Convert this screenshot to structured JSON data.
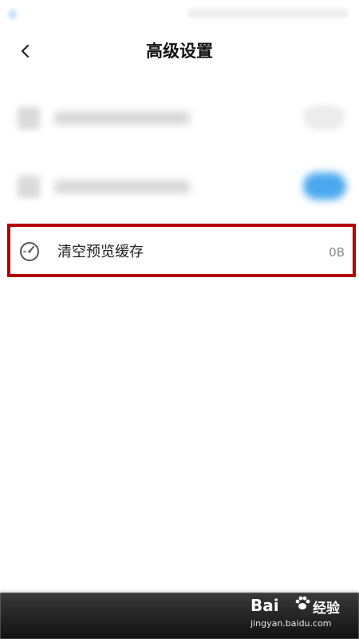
{
  "header": {
    "title": "高级设置",
    "back_icon": "chevron-left-icon"
  },
  "settings": {
    "blurred_items": [
      {
        "icon": "blurred-setting-icon",
        "toggle": "off"
      },
      {
        "icon": "blurred-setting-icon",
        "toggle": "on"
      }
    ],
    "clear_cache": {
      "label": "清空预览缓存",
      "value": "0B",
      "icon": "speedometer-icon"
    }
  },
  "watermark": {
    "brand": "Bai",
    "suffix": "经验",
    "url": "jingyan.baidu.com"
  },
  "colors": {
    "highlight": "#b40000",
    "toggle_on": "#4aa8ee",
    "icon_stroke": "#555555"
  }
}
